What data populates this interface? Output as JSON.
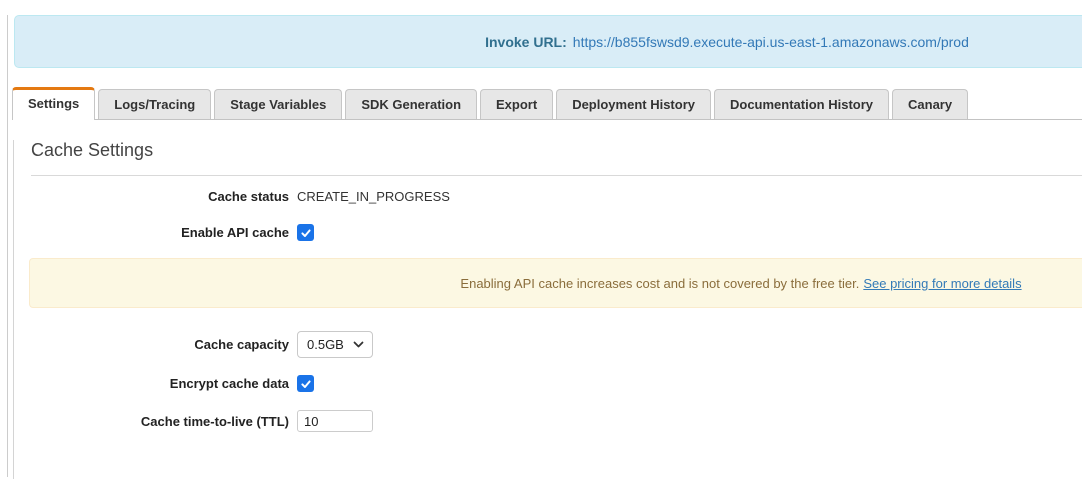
{
  "colors": {
    "accent_orange": "#e47911",
    "info_banner_bg": "#d9edf7",
    "info_banner_text": "#31708f",
    "warning_banner_bg": "#fcf8e3",
    "warning_banner_text": "#8a6d3b",
    "link_blue": "#337ab7",
    "checkbox_blue": "#1a73e8"
  },
  "invoke_banner": {
    "label": "Invoke URL:",
    "url": "https://b855fswsd9.execute-api.us-east-1.amazonaws.com/prod"
  },
  "tabs": [
    {
      "label": "Settings",
      "active": true
    },
    {
      "label": "Logs/Tracing",
      "active": false
    },
    {
      "label": "Stage Variables",
      "active": false
    },
    {
      "label": "SDK Generation",
      "active": false
    },
    {
      "label": "Export",
      "active": false
    },
    {
      "label": "Deployment History",
      "active": false
    },
    {
      "label": "Documentation History",
      "active": false
    },
    {
      "label": "Canary",
      "active": false
    }
  ],
  "cache_settings": {
    "title": "Cache Settings",
    "cache_status": {
      "label": "Cache status",
      "value": "CREATE_IN_PROGRESS"
    },
    "enable_api_cache": {
      "label": "Enable API cache",
      "checked": true
    },
    "warning": {
      "text": "Enabling API cache increases cost and is not covered by the free tier.",
      "link_text": "See pricing for more details"
    },
    "cache_capacity": {
      "label": "Cache capacity",
      "value": "0.5GB"
    },
    "encrypt_cache_data": {
      "label": "Encrypt cache data",
      "checked": true
    },
    "cache_ttl": {
      "label": "Cache time-to-live (TTL)",
      "value": "10"
    }
  }
}
